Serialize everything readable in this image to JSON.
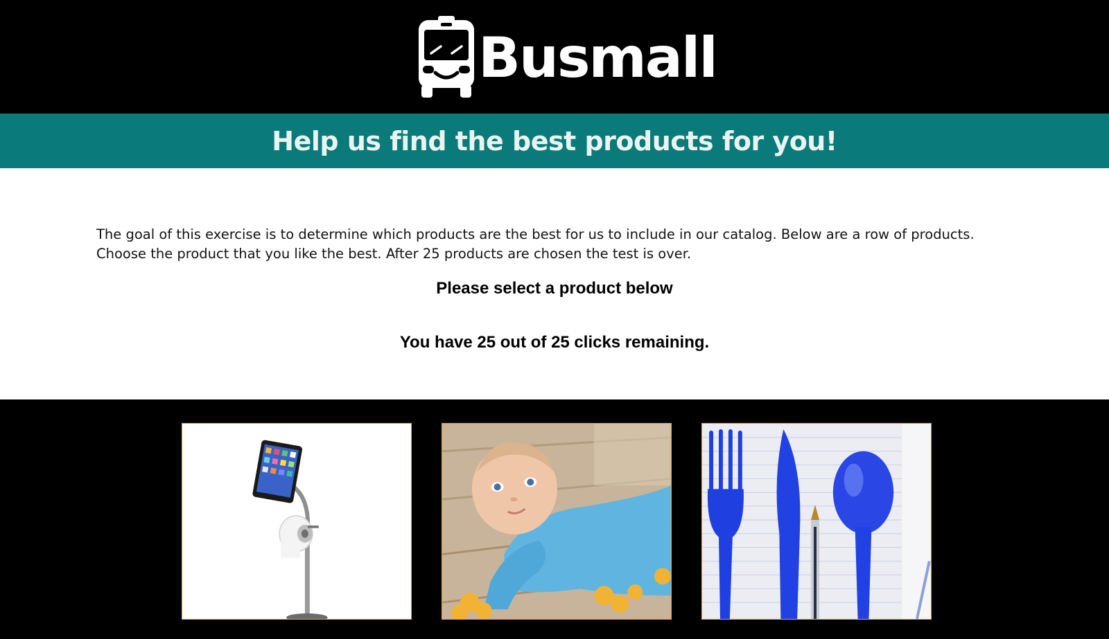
{
  "header": {
    "logo_text": "Busmall",
    "logo_icon": "bus-icon"
  },
  "banner": {
    "title": "Help us find the best products for you!"
  },
  "intro": {
    "text": "The goal of this exercise is to determine which products are the best for us to include in our catalog. Below are a row of products. Choose the product that you like the best. After 25 products are chosen the test is over."
  },
  "prompt": {
    "text": "Please select a product below"
  },
  "clicks": {
    "text": "You have 25 out of 25 clicks remaining.",
    "remaining": 25,
    "total": 25
  },
  "products": [
    {
      "name": "tablet stand with toilet paper holder",
      "icon": "tablet-toilet-paper-stand"
    },
    {
      "name": "baby mop onesie",
      "icon": "baby-mop"
    },
    {
      "name": "pen utensils",
      "icon": "pen-cutlery"
    }
  ],
  "colors": {
    "header_bg": "#000000",
    "banner_bg": "#0a7b7a",
    "banner_text": "#e9f4f2",
    "product_border": "#e6a23c"
  }
}
